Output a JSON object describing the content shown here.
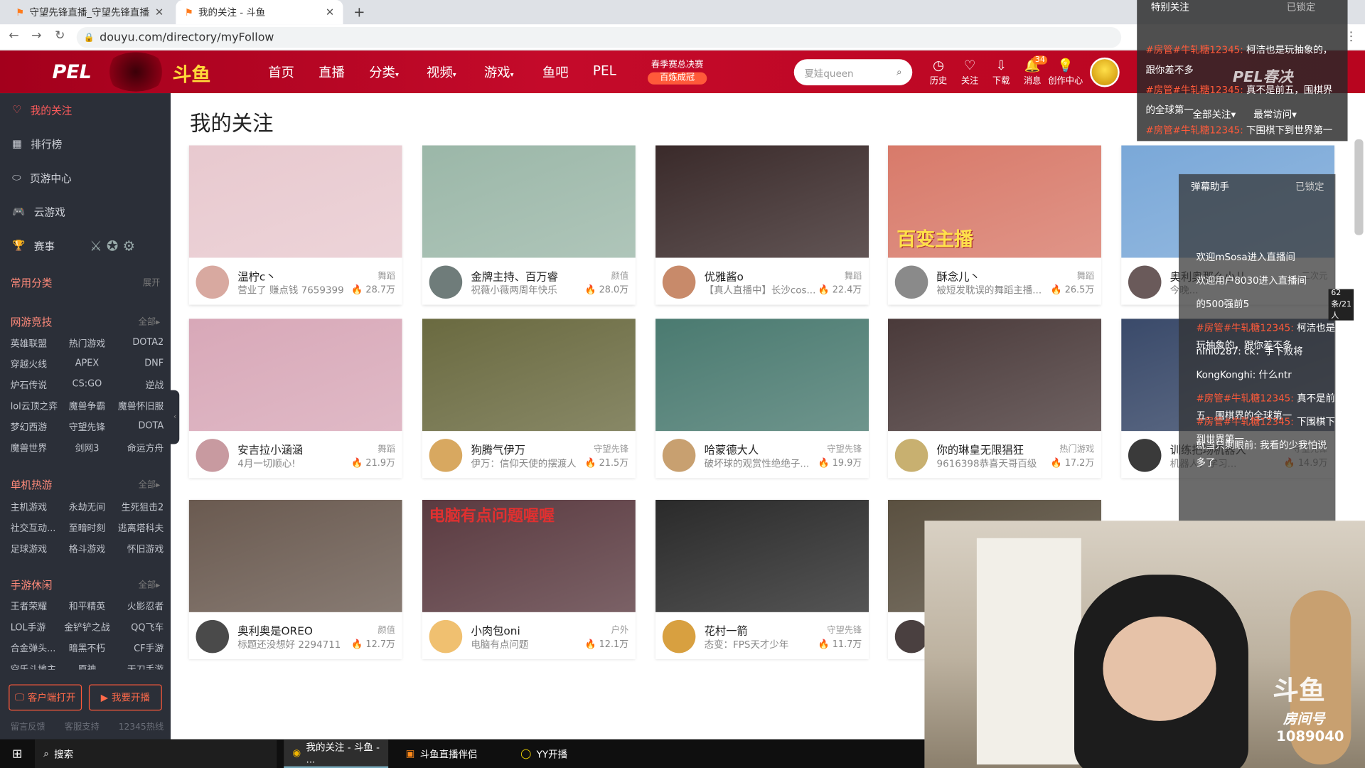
{
  "browser": {
    "tabs": [
      {
        "title": "守望先锋直播_守望先锋直播解说"
      },
      {
        "title": "我的关注 - 斗鱼"
      }
    ],
    "url": "douyu.com/directory/myFollow"
  },
  "header": {
    "brand_pel": "PEL",
    "brand_douyu": "斗鱼",
    "nav": [
      "首页",
      "直播",
      "分类",
      "视频",
      "游戏",
      "鱼吧",
      "PEL"
    ],
    "promo_line1": "春季赛总决赛",
    "promo_line2": "百炼成冠",
    "search_placeholder": "夏娃queen",
    "icons": [
      {
        "label": "历史",
        "icon": "clock-icon"
      },
      {
        "label": "关注",
        "icon": "heart-icon"
      },
      {
        "label": "下载",
        "icon": "download-icon"
      },
      {
        "label": "消息",
        "icon": "bell-icon"
      },
      {
        "label": "创作中心",
        "icon": "bulb-icon"
      }
    ],
    "message_badge": "34"
  },
  "sidebar": {
    "items": [
      {
        "label": "我的关注",
        "icon": "heart-icon"
      },
      {
        "label": "排行榜",
        "icon": "rank-icon"
      },
      {
        "label": "页游中心",
        "icon": "shield-icon"
      },
      {
        "label": "云游戏",
        "icon": "gamepad-icon"
      },
      {
        "label": "赛事",
        "icon": "trophy-icon"
      }
    ],
    "common_title": "常用分类",
    "common_more": "展开",
    "groups": [
      {
        "title": "网游竞技",
        "more": "全部",
        "items": [
          "英雄联盟",
          "热门游戏",
          "DOTA2",
          "穿越火线",
          "APEX",
          "DNF",
          "炉石传说",
          "CS:GO",
          "逆战",
          "lol云顶之弈",
          "魔兽争霸",
          "魔兽怀旧服",
          "梦幻西游",
          "守望先锋",
          "DOTA",
          "魔兽世界",
          "剑网3",
          "命运方舟"
        ]
      },
      {
        "title": "单机热游",
        "more": "全部",
        "items": [
          "主机游戏",
          "永劫无间",
          "生死狙击2",
          "社交互动...",
          "至暗时刻",
          "逃离塔科夫",
          "足球游戏",
          "格斗游戏",
          "怀旧游戏"
        ]
      },
      {
        "title": "手游休闲",
        "more": "全部",
        "items": [
          "王者荣耀",
          "和平精英",
          "火影忍者",
          "LOL手游",
          "金铲铲之战",
          "QQ飞车",
          "合金弹头...",
          "暗黑不朽",
          "CF手游",
          "空乐斗地主",
          "原神",
          "天刀手游"
        ]
      }
    ],
    "btn_client": "客户端打开",
    "btn_stream": "我要开播",
    "footer": [
      "留言反馈",
      "客服支持",
      "12345热线"
    ]
  },
  "main": {
    "title": "我的关注",
    "cards": [
      {
        "name": "温柠c丶",
        "cat": "舞蹈",
        "desc": "营业了 赚点钱 7659399",
        "pop": "28.7万",
        "thumb": "#e8c9cf",
        "av": "#d8a9a0"
      },
      {
        "name": "金牌主持、百万睿",
        "cat": "颜值",
        "desc": "祝薇小薇两周年快乐",
        "pop": "28.0万",
        "thumb": "#9bb7a8",
        "av": "#6f7c7a"
      },
      {
        "name": "优雅酱o",
        "cat": "舞蹈",
        "desc": "【真人直播中】长沙cos...",
        "pop": "22.4万",
        "thumb": "#3a2a2a",
        "av": "#c88a6a"
      },
      {
        "name": "酥念儿丶",
        "cat": "舞蹈",
        "desc": "被短发耽误的舞蹈主播...",
        "pop": "26.5万",
        "thumb": "#d87a6a",
        "av": "#8a8a8a"
      },
      {
        "name": "奥利奥那么小儿",
        "cat": "二次元",
        "desc": "今晚...",
        "pop": "",
        "thumb": "#7aa8d8",
        "av": "#6a5a5a"
      },
      {
        "name": "安吉拉小涵涵",
        "cat": "舞蹈",
        "desc": "4月一切顺心!",
        "pop": "21.9万",
        "thumb": "#d8a8b8",
        "av": "#c89aa0"
      },
      {
        "name": "狗腾气伊万",
        "cat": "守望先锋",
        "desc": "伊万：信仰天使的摆渡人",
        "pop": "21.5万",
        "thumb": "#6a6a40",
        "av": "#d8a860"
      },
      {
        "name": "哈蒙德大人",
        "cat": "守望先锋",
        "desc": "破坏球的观赏性绝绝子...",
        "pop": "19.9万",
        "thumb": "#4a7a70",
        "av": "#c8a070"
      },
      {
        "name": "你的琳皇无限猖狂",
        "cat": "热门游戏",
        "desc": "9616398恭喜天哥百级",
        "pop": "17.2万",
        "thumb": "#4a3a3a",
        "av": "#c8b070"
      },
      {
        "name": "训练把场机器人",
        "cat": "守望先锋",
        "desc": "机器人，学习...",
        "pop": "14.9万",
        "thumb": "#3a4a6a",
        "av": "#3a3a3a"
      },
      {
        "name": "奥利奥是OREO",
        "cat": "颜值",
        "desc": "标题还没想好 2294711",
        "pop": "12.7万",
        "thumb": "#6a5a50",
        "av": "#4a4a4a"
      },
      {
        "name": "小肉包oni",
        "cat": "户外",
        "desc": "电脑有点问题",
        "pop": "12.1万",
        "thumb": "#5a3a40",
        "av": "#f0c070"
      },
      {
        "name": "花村一箭",
        "cat": "守望先锋",
        "desc": "态变：FPS天才少年",
        "pop": "11.7万",
        "thumb": "#2a2a2a",
        "av": "#d8a040"
      },
      {
        "name": "",
        "cat": "",
        "desc": "",
        "pop": "",
        "thumb": "#5a5040",
        "av": "#4a4040"
      }
    ],
    "thumb_text": {
      "card2": "百变主播",
      "card11": "电脑有点问题喔喔"
    }
  },
  "overlay": {
    "title": "特别关注",
    "locked": "已锁定",
    "lines": [
      "柯洁也是玩抽象的，跟你差不多",
      "真不是前五，围棋界的全球第一",
      "下围棋下到世界第一"
    ],
    "filter1": "全部关注",
    "filter2": "最常访问",
    "pel_text": "PEL春决"
  },
  "chat": {
    "title": "弹幕助手",
    "locked": "已锁定",
    "lines": [
      {
        "user": "",
        "text": "欢迎mSosa进入直播间"
      },
      {
        "user": "",
        "text": "欢迎用户8030进入直播间"
      },
      {
        "user": "",
        "text": "的500强前5"
      },
      {
        "user": "#房管#牛轧糖12345:",
        "text": "柯洁也是玩抽象的，跟你差不多"
      },
      {
        "user": "nini0287:",
        "text": "ck：手下败将"
      },
      {
        "user": "KongKonghi:",
        "text": "什么ntr"
      },
      {
        "user": "#房管#牛轧糖12345:",
        "text": "真不是前五，围棋界的全球第一"
      },
      {
        "user": "#房管#牛轧糖12345:",
        "text": "下围棋下到世界第一"
      },
      {
        "user": "就当只剩眼前:",
        "text": "我看的少我怕说多了"
      }
    ],
    "stats": "62条/21人"
  },
  "cam": {
    "room_label": "房间号",
    "room_number": "1089040",
    "brand": "斗鱼"
  },
  "taskbar": {
    "search": "搜索",
    "apps": [
      "我的关注 - 斗鱼 - ...",
      "斗鱼直播伴侣",
      "YY开播"
    ]
  }
}
